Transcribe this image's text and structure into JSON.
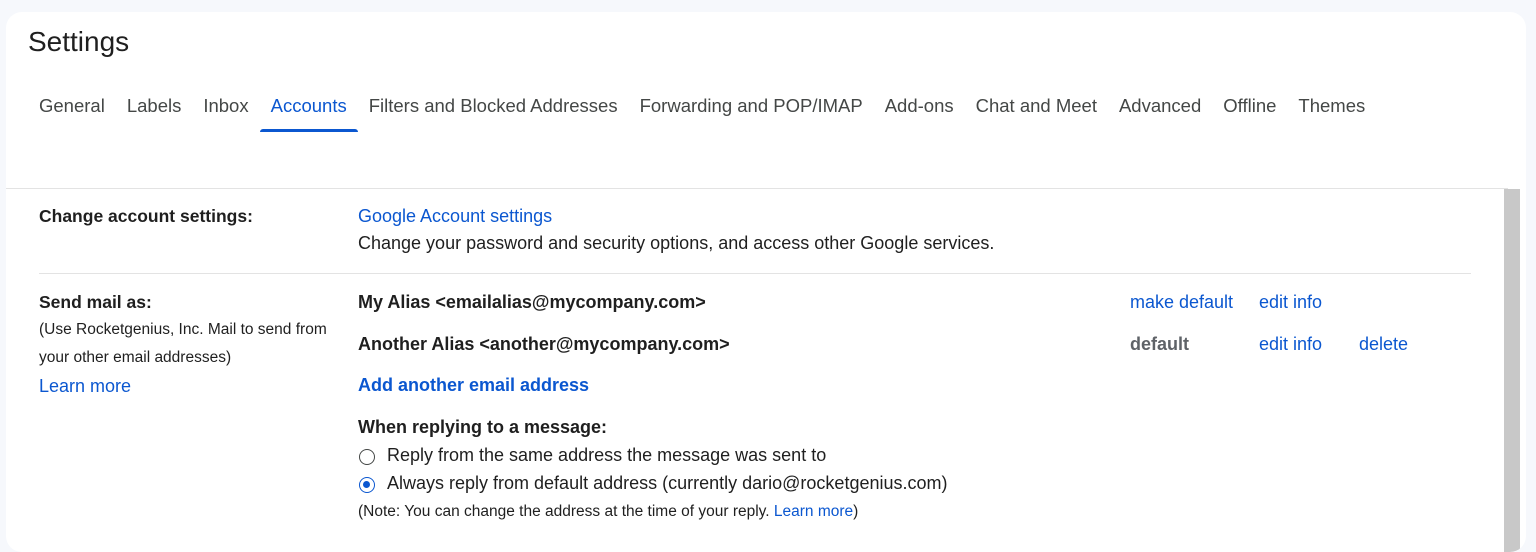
{
  "title": "Settings",
  "tabs": [
    {
      "label": "General"
    },
    {
      "label": "Labels"
    },
    {
      "label": "Inbox"
    },
    {
      "label": "Accounts",
      "active": true
    },
    {
      "label": "Filters and Blocked Addresses"
    },
    {
      "label": "Forwarding and POP/IMAP"
    },
    {
      "label": "Add-ons"
    },
    {
      "label": "Chat and Meet"
    },
    {
      "label": "Advanced"
    },
    {
      "label": "Offline"
    },
    {
      "label": "Themes"
    }
  ],
  "change_account": {
    "label": "Change account settings:",
    "link": "Google Account settings",
    "description": "Change your password and security options, and access other Google services."
  },
  "send_mail_as": {
    "label": "Send mail as:",
    "note_line1": "(Use Rocketgenius, Inc. Mail to send from",
    "note_line2": "your other email addresses)",
    "learn_more": "Learn more",
    "aliases": [
      {
        "address": "My Alias <emailalias@mycompany.com>",
        "status_action": "make default",
        "edit": "edit info"
      },
      {
        "address": "Another Alias <another@mycompany.com>",
        "status_action": "default",
        "edit": "edit info",
        "delete": "delete"
      }
    ],
    "add_address": "Add another email address",
    "reply_heading": "When replying to a message:",
    "reply_options": [
      {
        "label": "Reply from the same address the message was sent to",
        "checked": false
      },
      {
        "label": "Always reply from default address (currently dario@rocketgenius.com)",
        "checked": true
      }
    ],
    "reply_note_prefix": "(Note: You can change the address at the time of your reply. ",
    "reply_note_link": "Learn more",
    "reply_note_suffix": ")"
  },
  "colors": {
    "accent": "#0b57d0",
    "page_bg": "#f6f8fc",
    "panel_bg": "#ffffff"
  }
}
